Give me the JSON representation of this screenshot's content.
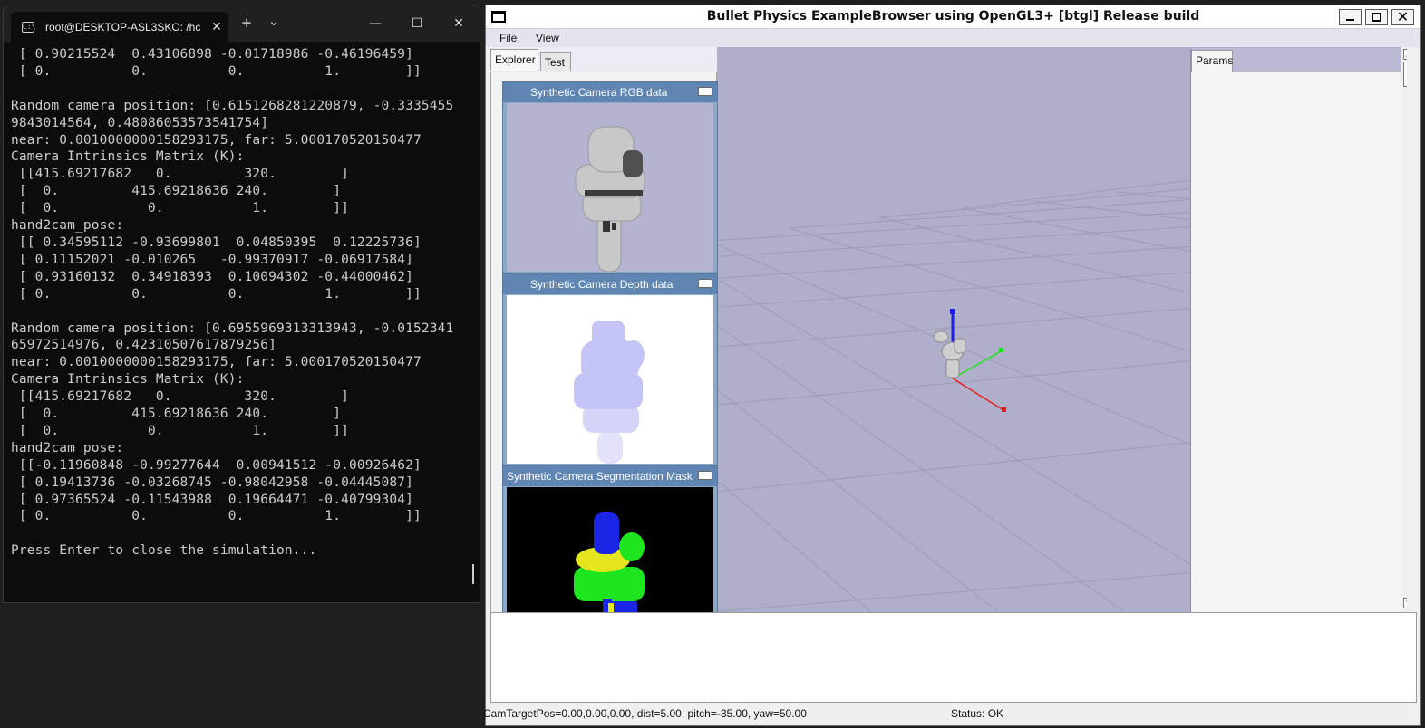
{
  "terminal": {
    "tab_title": "root@DESKTOP-ASL3SKO: /hc",
    "tab_icon": "terminal-icon",
    "new_tab": "+",
    "dropdown": "⌄",
    "controls": {
      "minimize": "—",
      "maximize": "☐",
      "close": "✕"
    },
    "lines": [
      " [ 0.90215524  0.43106898 -0.01718986 -0.46196459]",
      " [ 0.          0.          0.          1.        ]]",
      "",
      "Random camera position: [0.6151268281220879, -0.3335455",
      "9843014564, 0.48086053573541754]",
      "near: 0.0010000000158293175, far: 5.000170520150477",
      "Camera Intrinsics Matrix (K):",
      " [[415.69217682   0.         320.        ]",
      " [  0.         415.69218636 240.        ]",
      " [  0.           0.           1.        ]]",
      "hand2cam_pose:",
      " [[ 0.34595112 -0.93699801  0.04850395  0.12225736]",
      " [ 0.11152021 -0.010265   -0.99370917 -0.06917584]",
      " [ 0.93160132  0.34918393  0.10094302 -0.44000462]",
      " [ 0.          0.          0.          1.        ]]",
      "",
      "Random camera position: [0.6955969313313943, -0.0152341",
      "65972514976, 0.42310507617879256]",
      "near: 0.0010000000158293175, far: 5.000170520150477",
      "Camera Intrinsics Matrix (K):",
      " [[415.69217682   0.         320.        ]",
      " [  0.         415.69218636 240.        ]",
      " [  0.           0.           1.        ]]",
      "hand2cam_pose:",
      " [[-0.11960848 -0.99277644  0.00941512 -0.00926462]",
      " [ 0.19413736 -0.03268745 -0.98042958 -0.04445087]",
      " [ 0.97365524 -0.11543988  0.19664471 -0.40799304]",
      " [ 0.          0.          0.          1.        ]]",
      "",
      "Press Enter to close the simulation..."
    ]
  },
  "bullet": {
    "title": "Bullet Physics ExampleBrowser using OpenGL3+ [btgl] Release build",
    "menu": {
      "file": "File",
      "view": "View"
    },
    "tabs": {
      "explorer": "Explorer",
      "test": "Test",
      "params": "Params"
    },
    "panels": [
      {
        "title": "Synthetic Camera RGB data"
      },
      {
        "title": "Synthetic Camera Depth data"
      },
      {
        "title": "Synthetic Camera Segmentation Mask"
      }
    ],
    "status": {
      "camera": "CamTargetPos=0.00,0.00,0.00, dist=5.00, pitch=-35.00, yaw=50.00",
      "state": "Status: OK"
    },
    "colors": {
      "background": "#afafcc",
      "seg_blue": "#1a25e6",
      "seg_green": "#1ee61e",
      "seg_yellow": "#e6e61e",
      "axis_x": "#e61e1e",
      "axis_y": "#1ee61e",
      "axis_z": "#1e1ee6"
    }
  }
}
